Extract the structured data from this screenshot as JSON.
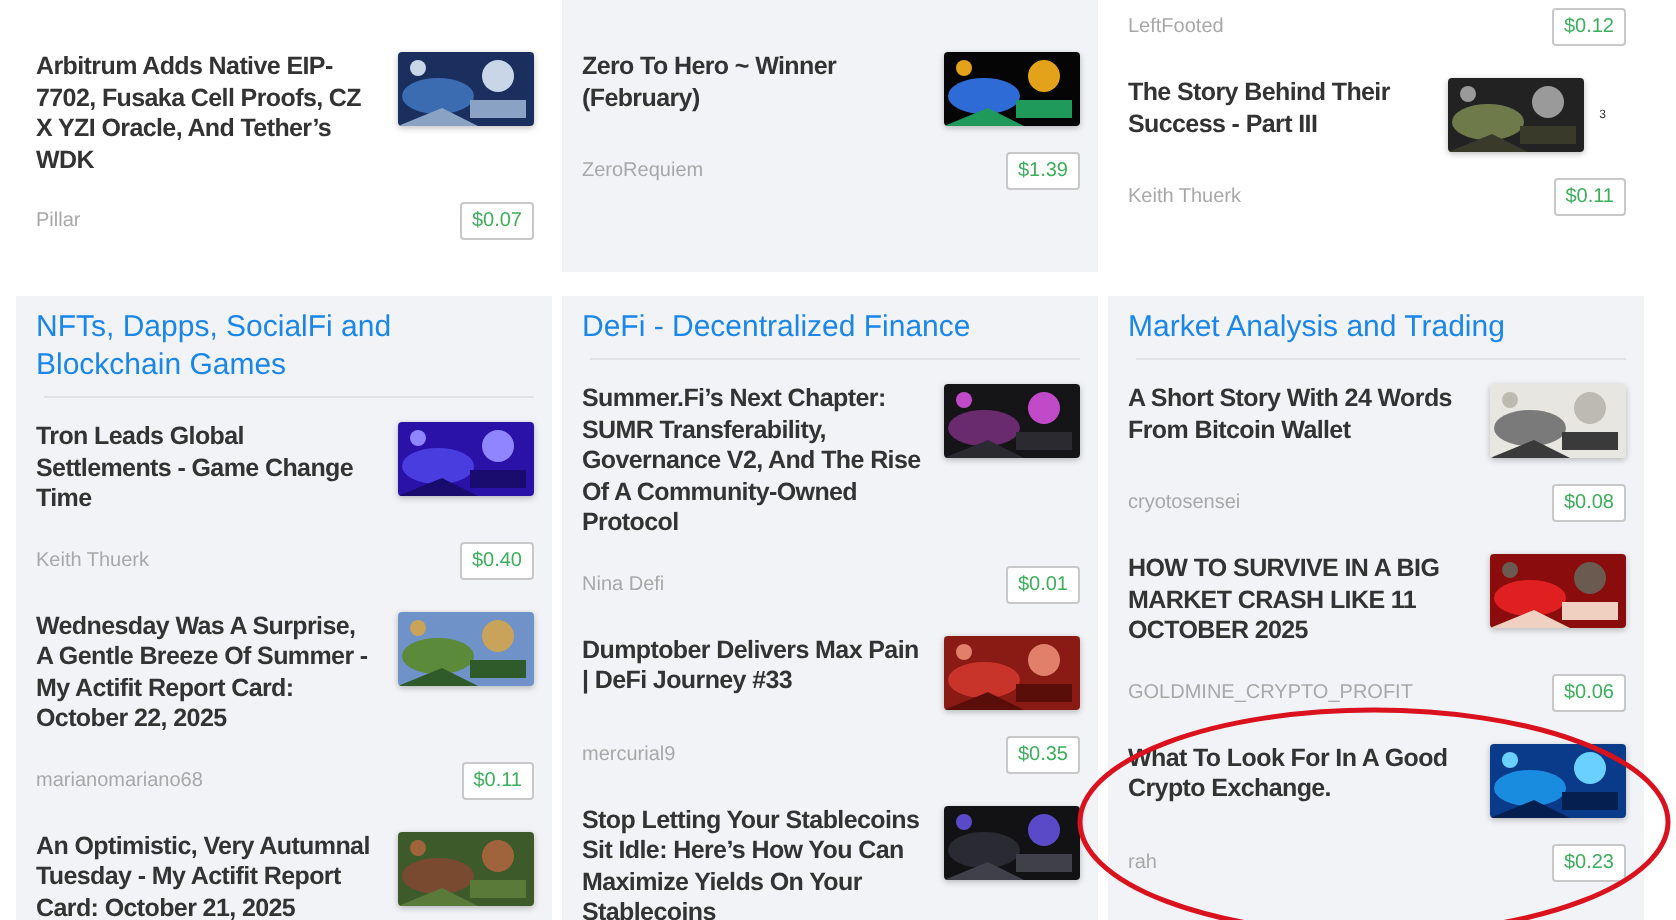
{
  "top_columns": [
    {
      "shaded": false,
      "items": [
        {
          "title": "Arbitrum Adds Native EIP-7702, Fusaka Cell Proofs, CZ X YZI Oracle, And Tether’s WDK",
          "author": "Pillar",
          "price": "$0.07"
        }
      ]
    },
    {
      "shaded": true,
      "items": [
        {
          "title": "Zero To Hero ~ Winner (February)",
          "author": "ZeroRequiem",
          "price": "$1.39"
        }
      ]
    },
    {
      "shaded": false,
      "items": [
        {
          "author": "LeftFooted",
          "price": "$0.12"
        },
        {
          "title": "The Story Behind Their Success - Part III",
          "thumb_caption": "3",
          "author": "Keith Thuerk",
          "price": "$0.11"
        }
      ]
    }
  ],
  "sections": [
    {
      "title": "NFTs, Dapps, SocialFi and Blockchain Games",
      "items": [
        {
          "title": "Tron Leads Global Settlements - Game Change Time",
          "author": "Keith Thuerk",
          "price": "$0.40"
        },
        {
          "title": "Wednesday Was A Surprise, A Gentle Breeze Of Summer - My Actifit Report Card: October 22, 2025",
          "author": "marianomariano68",
          "price": "$0.11"
        },
        {
          "title": "An Optimistic, Very Autumnal Tuesday - My Actifit Report Card: October 21, 2025"
        }
      ]
    },
    {
      "title": "DeFi - Decentralized Finance",
      "items": [
        {
          "title": "Summer.Fi’s Next Chapter: SUMR Transferability, Governance V2, And The Rise Of A Community-Owned Protocol",
          "author": "Nina Defi",
          "price": "$0.01"
        },
        {
          "title": "Dumptober Delivers Max Pain | DeFi Journey #33",
          "author": "mercurial9",
          "price": "$0.35"
        },
        {
          "title": "Stop Letting Your Stablecoins Sit Idle: Here’s How You Can Maximize Yields On Your Stablecoins"
        }
      ]
    },
    {
      "title": "Market Analysis and Trading",
      "items": [
        {
          "title": "A Short Story With 24 Words From Bitcoin Wallet",
          "author": "cryotosensei",
          "price": "$0.08"
        },
        {
          "title": "HOW TO SURVIVE IN A BIG MARKET CRASH LIKE 11 OCTOBER 2025",
          "author": "GOLDMINE_CRYPTO_PROFIT",
          "price": "$0.06"
        },
        {
          "title": "What To Look For In A Good Crypto Exchange.",
          "author": "rah",
          "price": "$0.23",
          "circled": true
        }
      ]
    }
  ]
}
